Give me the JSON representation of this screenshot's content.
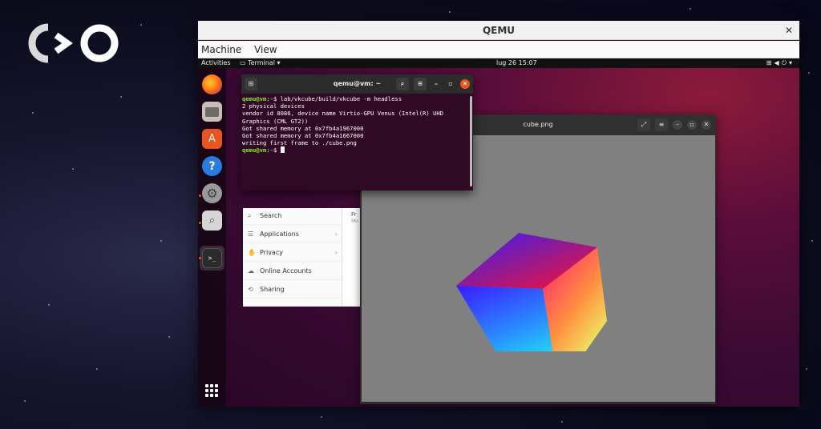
{
  "qemu_window": {
    "title": "QEMU",
    "menu": [
      "Machine",
      "View"
    ]
  },
  "topbar": {
    "activities": "Activities",
    "app_menu": "Terminal ▾",
    "clock": "lug 26  15:07"
  },
  "dock": {
    "icons": [
      "firefox-icon",
      "files-icon",
      "software-icon",
      "help-icon",
      "settings-icon",
      "search-icon",
      "terminal-icon",
      "apps-grid-icon"
    ]
  },
  "terminal": {
    "title": "qemu@vm: ~",
    "prompt_user": "qemu@vm",
    "prompt_path": "~",
    "command": "lab/vkcube/build/vkcube -m headless",
    "output": [
      "2 physical devices",
      "vendor id 8086, device name Virtio-GPU Venus (Intel(R) UHD Graphics (CML GT2))",
      "Got shared memory at 0x7fb4a1967000",
      "Got shared memory at 0x7fb4a1667000",
      "writing first frame to ./cube.png"
    ]
  },
  "settings": {
    "items": [
      "Search",
      "Applications",
      "Privacy",
      "Online Accounts",
      "Sharing"
    ],
    "main_partial": "Fr",
    "main_partial2": "Mo"
  },
  "viewer": {
    "title": "cube.png"
  },
  "colors": {
    "ubuntu_orange": "#e95420",
    "terminal_bg": "#300a24",
    "prompt_green": "#8ae234",
    "prompt_blue": "#729fcf",
    "image_bg": "#808080"
  }
}
